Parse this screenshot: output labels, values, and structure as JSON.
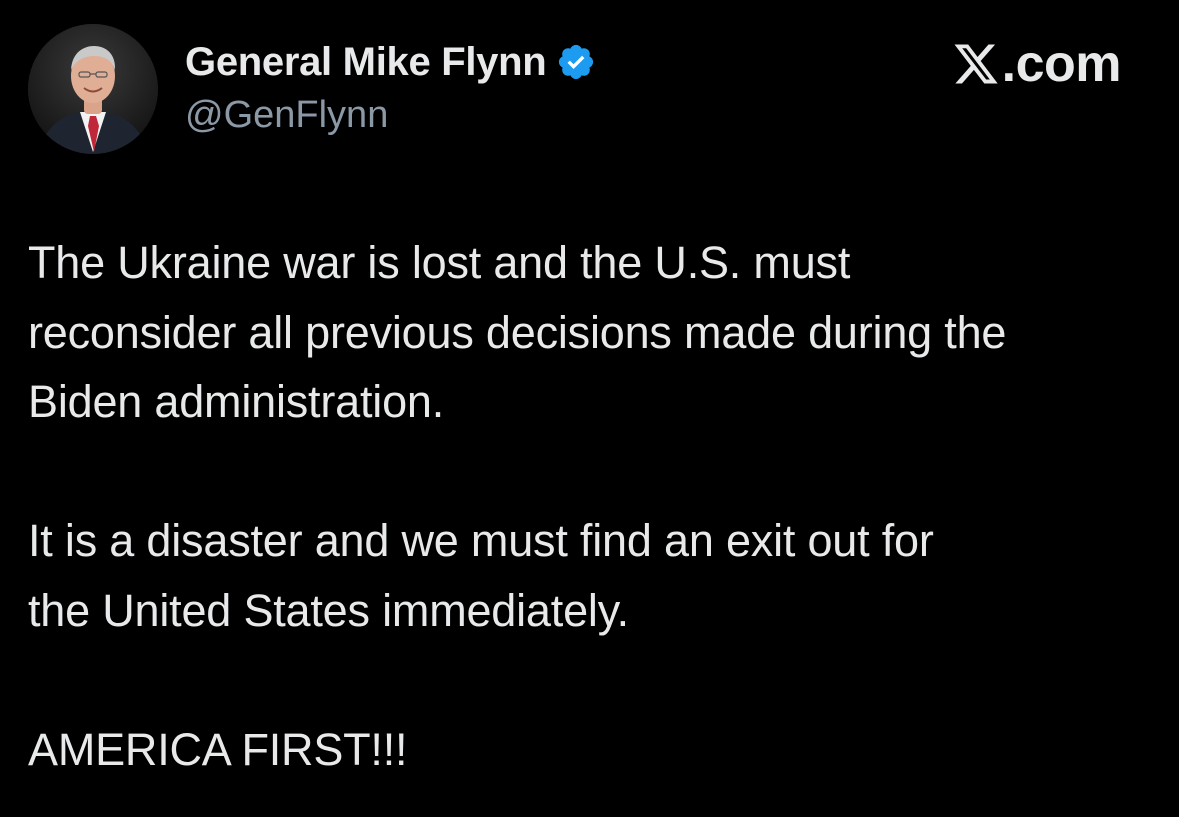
{
  "author": {
    "display_name": "General Mike Flynn",
    "handle": "@GenFlynn",
    "verified": true,
    "verified_color": "#1d9bf0"
  },
  "brand": {
    "text": ".com",
    "logo_icon": "x-logo-icon"
  },
  "tweet": {
    "paragraphs": [
      "The Ukraine war is lost and the U.S. must\nreconsider all previous decisions made during the\nBiden administration.",
      "It is a disaster and we must find an exit out for\nthe United States immediately.",
      "AMERICA FIRST!!!"
    ]
  },
  "colors": {
    "background": "#000000",
    "text_primary": "#e7e9ea",
    "text_secondary": "#8b98a5"
  }
}
